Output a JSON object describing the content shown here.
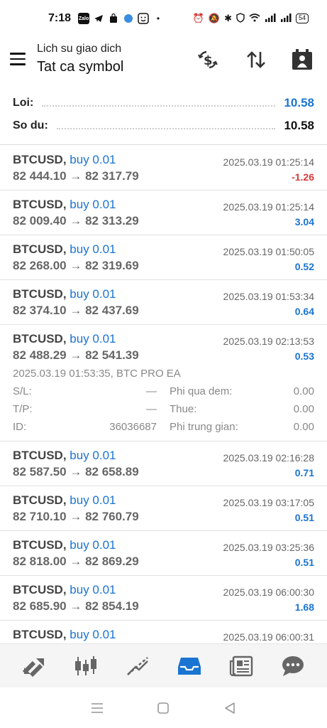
{
  "status_bar": {
    "time": "7:18",
    "battery": "54"
  },
  "header": {
    "subtitle": "Lich su giao dich",
    "title": "Tat ca symbol"
  },
  "summary": {
    "profit_label": "Loi:",
    "profit_value": "10.58",
    "balance_label": "So du:",
    "balance_value": "10.58"
  },
  "deals": [
    {
      "symbol": "BTCUSD,",
      "type": "buy 0.01",
      "prices": "82 444.10 → 82 317.79",
      "time": "2025.03.19 01:25:14",
      "profit": "-1.26",
      "profit_color": "#d93a3a"
    },
    {
      "symbol": "BTCUSD,",
      "type": "buy 0.01",
      "prices": "82 009.40 → 82 313.29",
      "time": "2025.03.19 01:25:14",
      "profit": "3.04",
      "profit_color": "#1a74d1"
    },
    {
      "symbol": "BTCUSD,",
      "type": "buy 0.01",
      "prices": "82 268.00 → 82 319.69",
      "time": "2025.03.19 01:50:05",
      "profit": "0.52",
      "profit_color": "#1a74d1"
    },
    {
      "symbol": "BTCUSD,",
      "type": "buy 0.01",
      "prices": "82 374.10 → 82 437.69",
      "time": "2025.03.19 01:53:34",
      "profit": "0.64",
      "profit_color": "#1a74d1"
    },
    {
      "symbol": "BTCUSD,",
      "type": "buy 0.01",
      "prices": "82 488.29 → 82 541.39",
      "time": "2025.03.19 02:13:53",
      "profit": "0.53",
      "profit_color": "#1a74d1",
      "details": {
        "info": "2025.03.19 01:53:35, BTC PRO EA",
        "sl_label": "S/L:",
        "sl_value": "—",
        "swap_label": "Phi qua dem:",
        "swap_value": "0.00",
        "tp_label": "T/P:",
        "tp_value": "—",
        "tax_label": "Thue:",
        "tax_value": "0.00",
        "id_label": "ID:",
        "id_value": "36036687",
        "commission_label": "Phi trung gian:",
        "commission_value": "0.00"
      }
    },
    {
      "symbol": "BTCUSD,",
      "type": "buy 0.01",
      "prices": "82 587.50 → 82 658.89",
      "time": "2025.03.19 02:16:28",
      "profit": "0.71",
      "profit_color": "#1a74d1"
    },
    {
      "symbol": "BTCUSD,",
      "type": "buy 0.01",
      "prices": "82 710.10 → 82 760.79",
      "time": "2025.03.19 03:17:05",
      "profit": "0.51",
      "profit_color": "#1a74d1"
    },
    {
      "symbol": "BTCUSD,",
      "type": "buy 0.01",
      "prices": "82 818.00 → 82 869.29",
      "time": "2025.03.19 03:25:36",
      "profit": "0.51",
      "profit_color": "#1a74d1"
    },
    {
      "symbol": "BTCUSD,",
      "type": "buy 0.01",
      "prices": "82 685.90 → 82 854.19",
      "time": "2025.03.19 06:00:30",
      "profit": "1.68",
      "profit_color": "#1a74d1"
    },
    {
      "symbol": "BTCUSD,",
      "type": "buy 0.01",
      "prices": "",
      "time": "2025.03.19 06:00:31",
      "profit": "",
      "profit_color": "#1a74d1"
    }
  ],
  "colors": {
    "accent": "#1a74d1",
    "loss": "#d93a3a"
  },
  "bottom_nav": [
    "quotes-icon",
    "chart-icon",
    "trade-icon",
    "history-icon",
    "news-icon",
    "chat-icon"
  ],
  "bottom_nav_active": "history-icon"
}
